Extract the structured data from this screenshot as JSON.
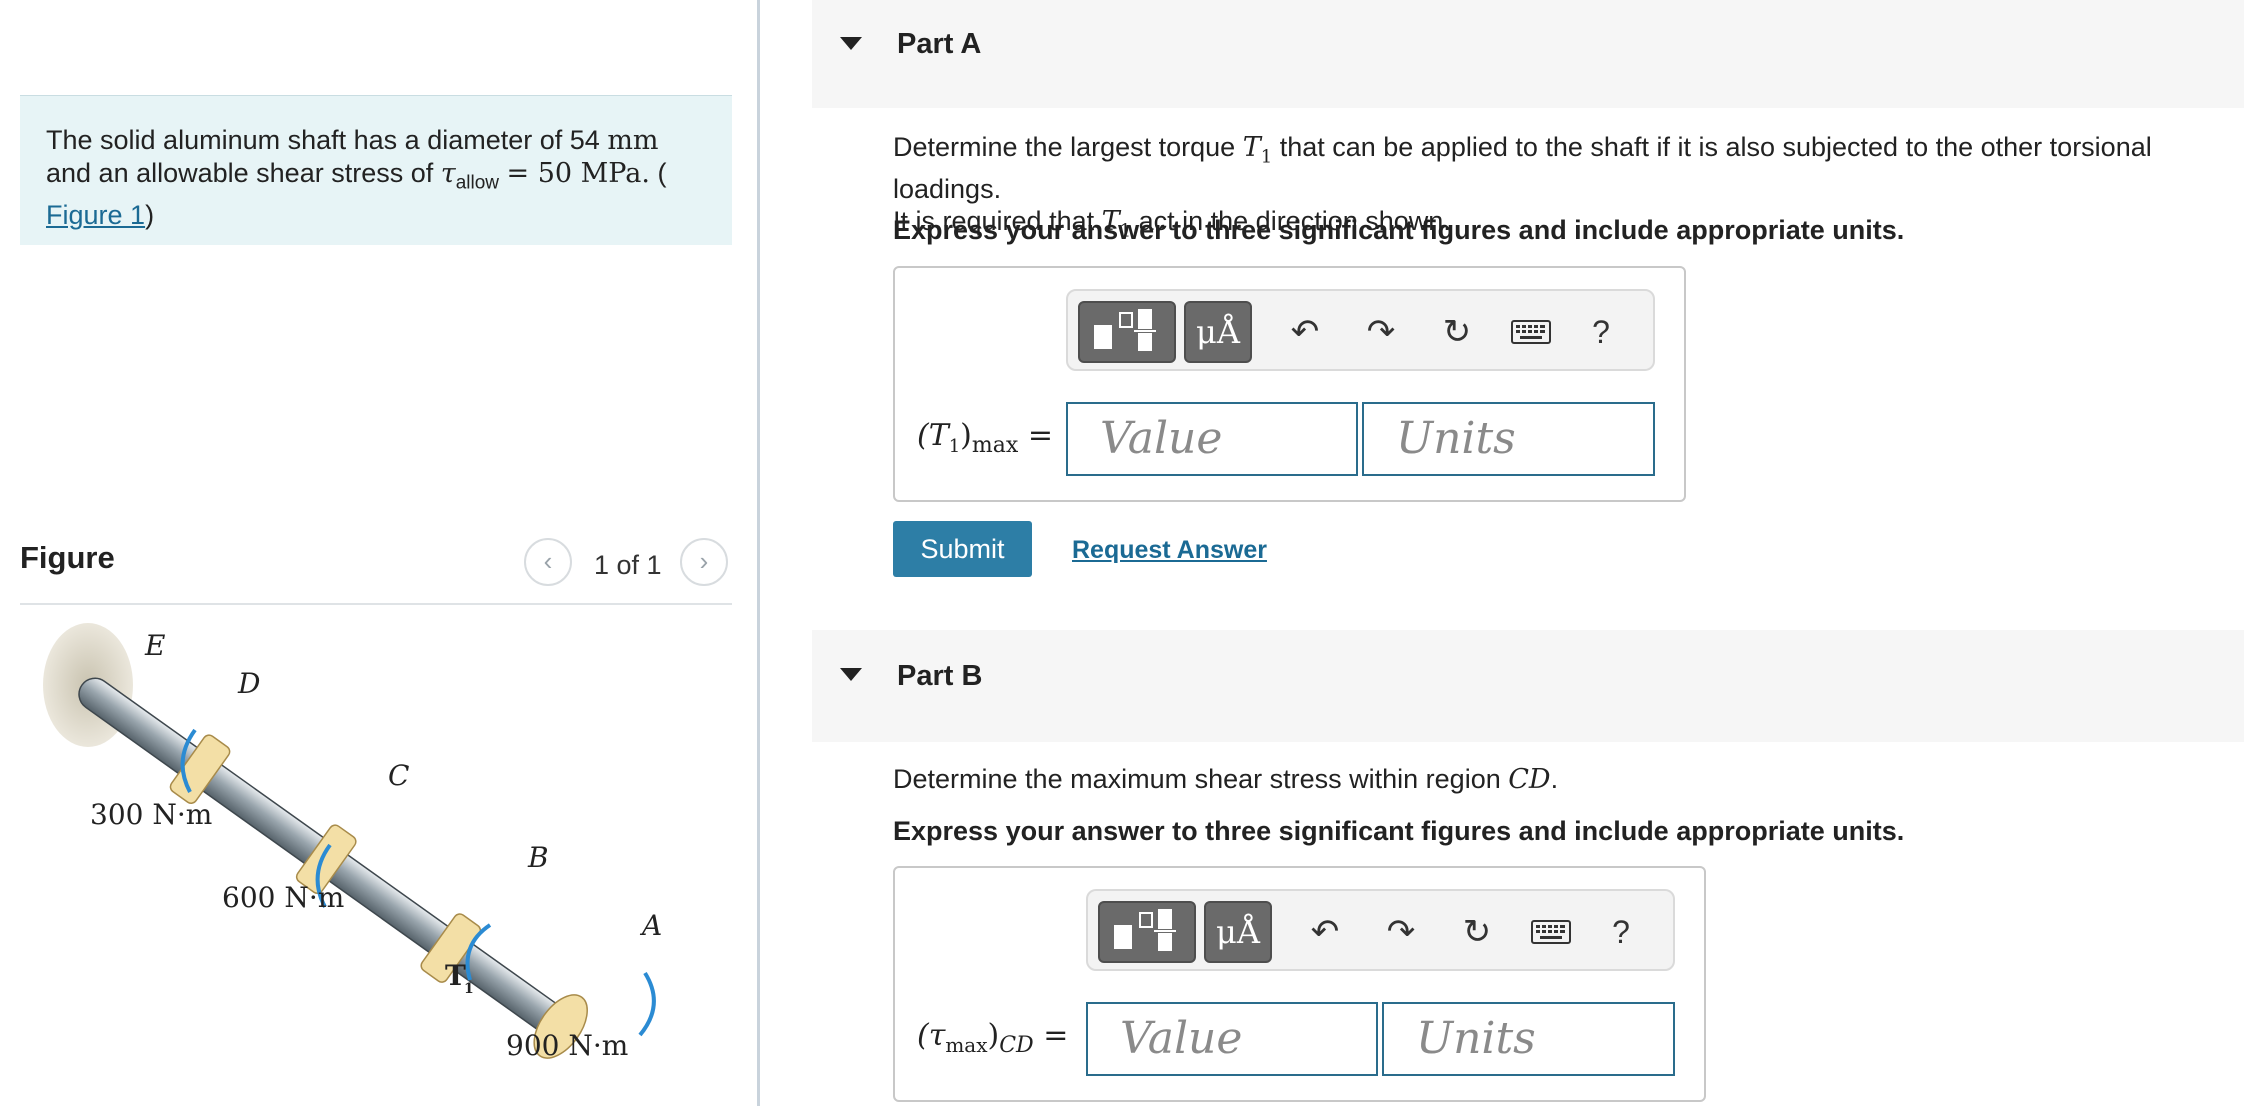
{
  "problem": {
    "text1": "The solid aluminum shaft has a diameter of 54",
    "unit_mm": "mm",
    "text2": "and an allowable shear stress of",
    "tau": "τ",
    "tau_sub": "allow",
    "eq_value": "= 50 MPa.",
    "paren_open": "(",
    "figure_link": "Figure 1",
    "paren_close": ")"
  },
  "figure": {
    "title": "Figure",
    "pager": "1 of 1",
    "prev_icon": "chevron-left-icon",
    "next_icon": "chevron-right-icon",
    "labels": {
      "E": "E",
      "D": "D",
      "C": "C",
      "B": "B",
      "A": "A",
      "T1": "T",
      "T1_sub": "1",
      "t300": "300 N·m",
      "t600": "600 N·m",
      "t900": "900 N·m"
    }
  },
  "partA": {
    "title": "Part A",
    "q1": "Determine the largest torque",
    "q_T": "T",
    "q_sub": "1",
    "q2": "that can be applied to the shaft if it is also subjected to the other torsional loadings.",
    "q3": "It is required that",
    "q4": "act in the direction shown.",
    "instruction": "Express your answer to three significant figures and include appropriate units.",
    "label_main": "(T",
    "label_sub1": "1",
    "label_close": ")",
    "label_sub2": "max",
    "label_eq": "=",
    "value_placeholder": "Value",
    "units_placeholder": "Units",
    "submit": "Submit",
    "request": "Request Answer"
  },
  "partB": {
    "title": "Part B",
    "q1": "Determine the maximum shear stress within region",
    "q_region": "CD",
    "q_end": ".",
    "instruction": "Express your answer to three significant figures and include appropriate units.",
    "label_open": "(τ",
    "label_sub1": "max",
    "label_close": ")",
    "label_sub2": "CD",
    "label_eq": "=",
    "value_placeholder": "Value",
    "units_placeholder": "Units"
  },
  "toolbar": {
    "templates_icon": "templates-icon",
    "units_btn": "μÅ",
    "undo_icon": "undo-icon",
    "redo_icon": "redo-icon",
    "reset_icon": "reset-icon",
    "keyboard_icon": "keyboard-icon",
    "help": "?"
  },
  "colors": {
    "accent": "#2d7ea6",
    "link": "#1b6a94",
    "problem_bg": "#e7f4f6",
    "part_bg": "#f6f6f6"
  }
}
